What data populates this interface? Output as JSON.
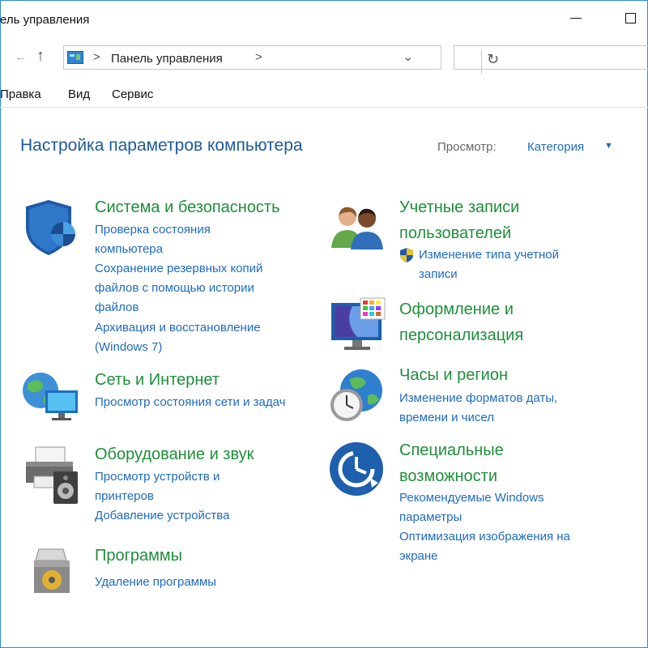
{
  "window": {
    "title": "ель управления"
  },
  "navigation": {
    "back_icon": "back-arrow-icon",
    "up_icon": "up-arrow-icon",
    "address_icon": "control-panel-icon",
    "address_sep": ">",
    "address": "Панель управления",
    "address_trail_sep": ">",
    "dropdown_icon": "chevron-down-icon",
    "refresh_icon": "refresh-icon",
    "search_placeholder": ""
  },
  "menu": {
    "items": [
      "Правка",
      "Вид",
      "Сервис"
    ]
  },
  "content": {
    "heading": "Настройка параметров компьютера",
    "view_label": "Просмотр:",
    "view_value": "Категория",
    "view_arrow": "▼"
  },
  "categories": [
    {
      "icon": "shield-icon",
      "title": "Система и безопасность",
      "links": [
        "Проверка состояния компьютера",
        "Сохранение резервных копий файлов с помощью истории файлов",
        "Архивация и восстановление (Windows 7)"
      ]
    },
    {
      "icon": "network-globe-icon",
      "title": "Сеть и Интернет",
      "links": [
        "Просмотр состояния сети и задач"
      ]
    },
    {
      "icon": "printer-speaker-icon",
      "title": "Оборудование и звук",
      "links": [
        "Просмотр устройств и принтеров",
        "Добавление устройства"
      ]
    },
    {
      "icon": "programs-box-icon",
      "title": "Программы",
      "links": [
        "Удаление программы"
      ]
    },
    {
      "icon": "users-icon",
      "title": "Учетные записи пользователей",
      "links": [
        "Изменение типа учетной записи"
      ]
    },
    {
      "icon": "personalization-monitor-icon",
      "title": "Оформление и персонализация",
      "links": []
    },
    {
      "icon": "clock-globe-icon",
      "title": "Часы и регион",
      "links": [
        "Изменение форматов даты, времени и чисел"
      ]
    },
    {
      "icon": "ease-of-access-icon",
      "title": "Специальные возможности",
      "links": [
        "Рекомендуемые Windows параметры",
        "Оптимизация изображения на экране"
      ]
    }
  ],
  "colors": {
    "category_title": "#1e8f3a",
    "link": "#1e6bbf",
    "heading": "#1e5a9b",
    "window_border": "#2b8dd6"
  }
}
